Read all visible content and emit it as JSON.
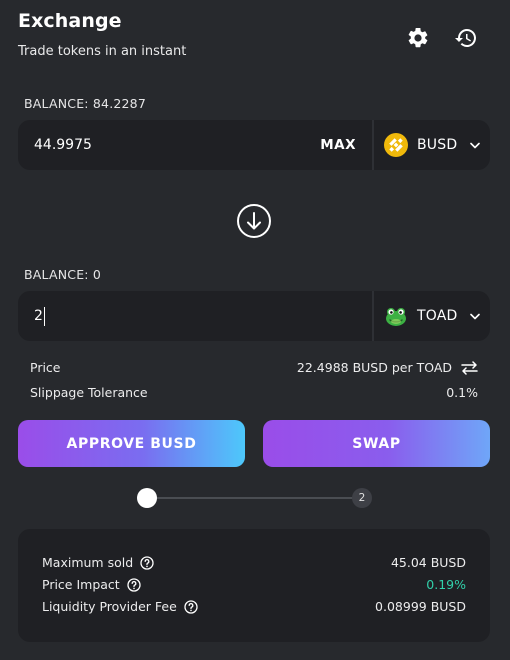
{
  "header": {
    "title": "Exchange",
    "subtitle": "Trade tokens in an instant"
  },
  "from": {
    "balance": "BALANCE: 84.2287",
    "amount": "44.9975",
    "max_label": "MAX",
    "token": "BUSD",
    "token_icon": "busd-icon"
  },
  "to": {
    "balance": "BALANCE: 0",
    "amount": "2",
    "token": "TOAD",
    "token_icon": "toad-icon"
  },
  "info": {
    "price_label": "Price",
    "price_value": "22.4988 BUSD per TOAD",
    "slippage_label": "Slippage Tolerance",
    "slippage_value": "0.1%"
  },
  "actions": {
    "approve_label": "APPROVE BUSD",
    "swap_label": "SWAP"
  },
  "steps": {
    "current": 1,
    "total": 2,
    "step2_label": "2"
  },
  "summary": {
    "max_sold_label": "Maximum sold",
    "max_sold_value": "45.04 BUSD",
    "price_impact_label": "Price Impact",
    "price_impact_value": "0.19%",
    "lp_fee_label": "Liquidity Provider Fee",
    "lp_fee_value": "0.08999 BUSD"
  },
  "colors": {
    "background": "#27292d",
    "panel": "#1f2024",
    "busd": "#f0b90b",
    "positive": "#31d0aa",
    "gradient_start": "#9a4de9",
    "gradient_end": "#4dc8fb"
  }
}
